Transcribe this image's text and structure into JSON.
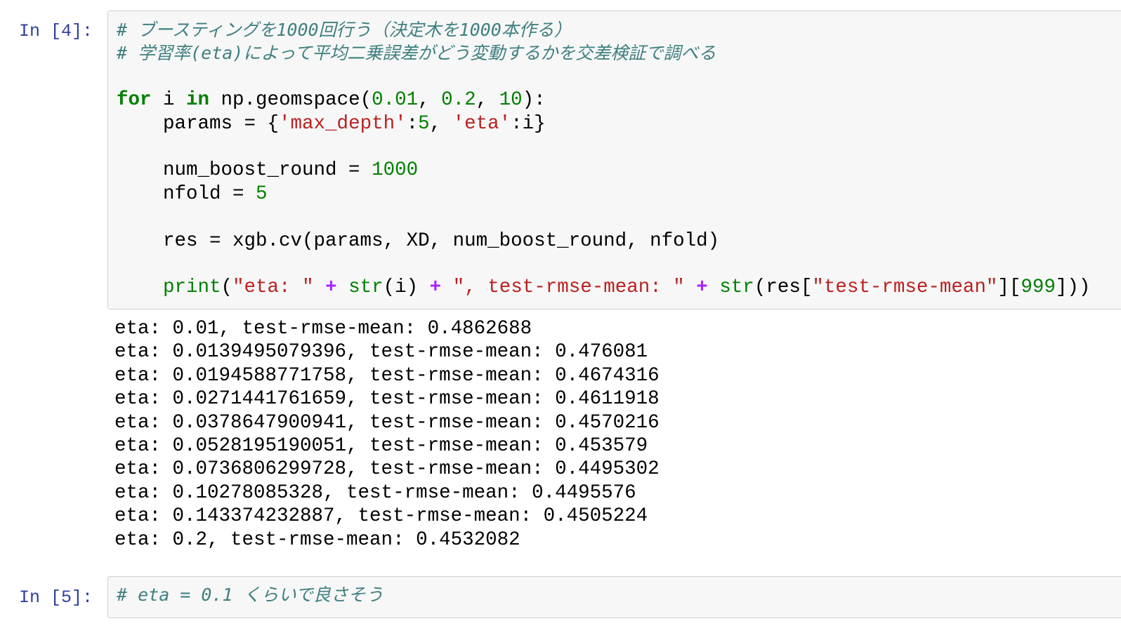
{
  "cells": [
    {
      "prompt": "In [4]:",
      "code_lines": [
        [
          [
            "c",
            "# ブースティングを1000回行う（決定木を1000本作る）"
          ]
        ],
        [
          [
            "c",
            "# 学習率(eta)によって平均二乗誤差がどう変動するかを交差検証で調べる"
          ]
        ],
        [],
        [
          [
            "k",
            "for"
          ],
          [
            "t",
            " i "
          ],
          [
            "k",
            "in"
          ],
          [
            "t",
            " np.geomspace("
          ],
          [
            "n",
            "0.01"
          ],
          [
            "t",
            ", "
          ],
          [
            "n",
            "0.2"
          ],
          [
            "t",
            ", "
          ],
          [
            "n",
            "10"
          ],
          [
            "t",
            "):"
          ]
        ],
        [
          [
            "t",
            "    params = {"
          ],
          [
            "s",
            "'max_depth'"
          ],
          [
            "t",
            ":"
          ],
          [
            "n",
            "5"
          ],
          [
            "t",
            ", "
          ],
          [
            "s",
            "'eta'"
          ],
          [
            "t",
            ":i}"
          ]
        ],
        [],
        [
          [
            "t",
            "    num_boost_round = "
          ],
          [
            "n",
            "1000"
          ]
        ],
        [
          [
            "t",
            "    nfold = "
          ],
          [
            "n",
            "5"
          ]
        ],
        [],
        [
          [
            "t",
            "    res = xgb.cv(params, XD, num_boost_round, nfold)"
          ]
        ],
        [],
        [
          [
            "t",
            "    "
          ],
          [
            "b",
            "print"
          ],
          [
            "t",
            "("
          ],
          [
            "s",
            "\"eta: \""
          ],
          [
            "t",
            " "
          ],
          [
            "o",
            "+"
          ],
          [
            "t",
            " "
          ],
          [
            "b",
            "str"
          ],
          [
            "t",
            "(i) "
          ],
          [
            "o",
            "+"
          ],
          [
            "t",
            " "
          ],
          [
            "s",
            "\", test-rmse-mean: \""
          ],
          [
            "t",
            " "
          ],
          [
            "o",
            "+"
          ],
          [
            "t",
            " "
          ],
          [
            "b",
            "str"
          ],
          [
            "t",
            "(res["
          ],
          [
            "s",
            "\"test-rmse-mean\""
          ],
          [
            "t",
            "]["
          ],
          [
            "n",
            "999"
          ],
          [
            "t",
            "]))"
          ]
        ]
      ],
      "output_lines": [
        "eta: 0.01, test-rmse-mean: 0.4862688",
        "eta: 0.0139495079396, test-rmse-mean: 0.476081",
        "eta: 0.0194588771758, test-rmse-mean: 0.4674316",
        "eta: 0.0271441761659, test-rmse-mean: 0.4611918",
        "eta: 0.0378647900941, test-rmse-mean: 0.4570216",
        "eta: 0.0528195190051, test-rmse-mean: 0.453579",
        "eta: 0.0736806299728, test-rmse-mean: 0.4495302",
        "eta: 0.10278085328, test-rmse-mean: 0.4495576",
        "eta: 0.143374232887, test-rmse-mean: 0.4505224",
        "eta: 0.2, test-rmse-mean: 0.4532082"
      ]
    },
    {
      "prompt": "In [5]:",
      "code_lines": [
        [
          [
            "c",
            "# eta = 0.1 くらいで良さそう"
          ]
        ]
      ]
    }
  ]
}
